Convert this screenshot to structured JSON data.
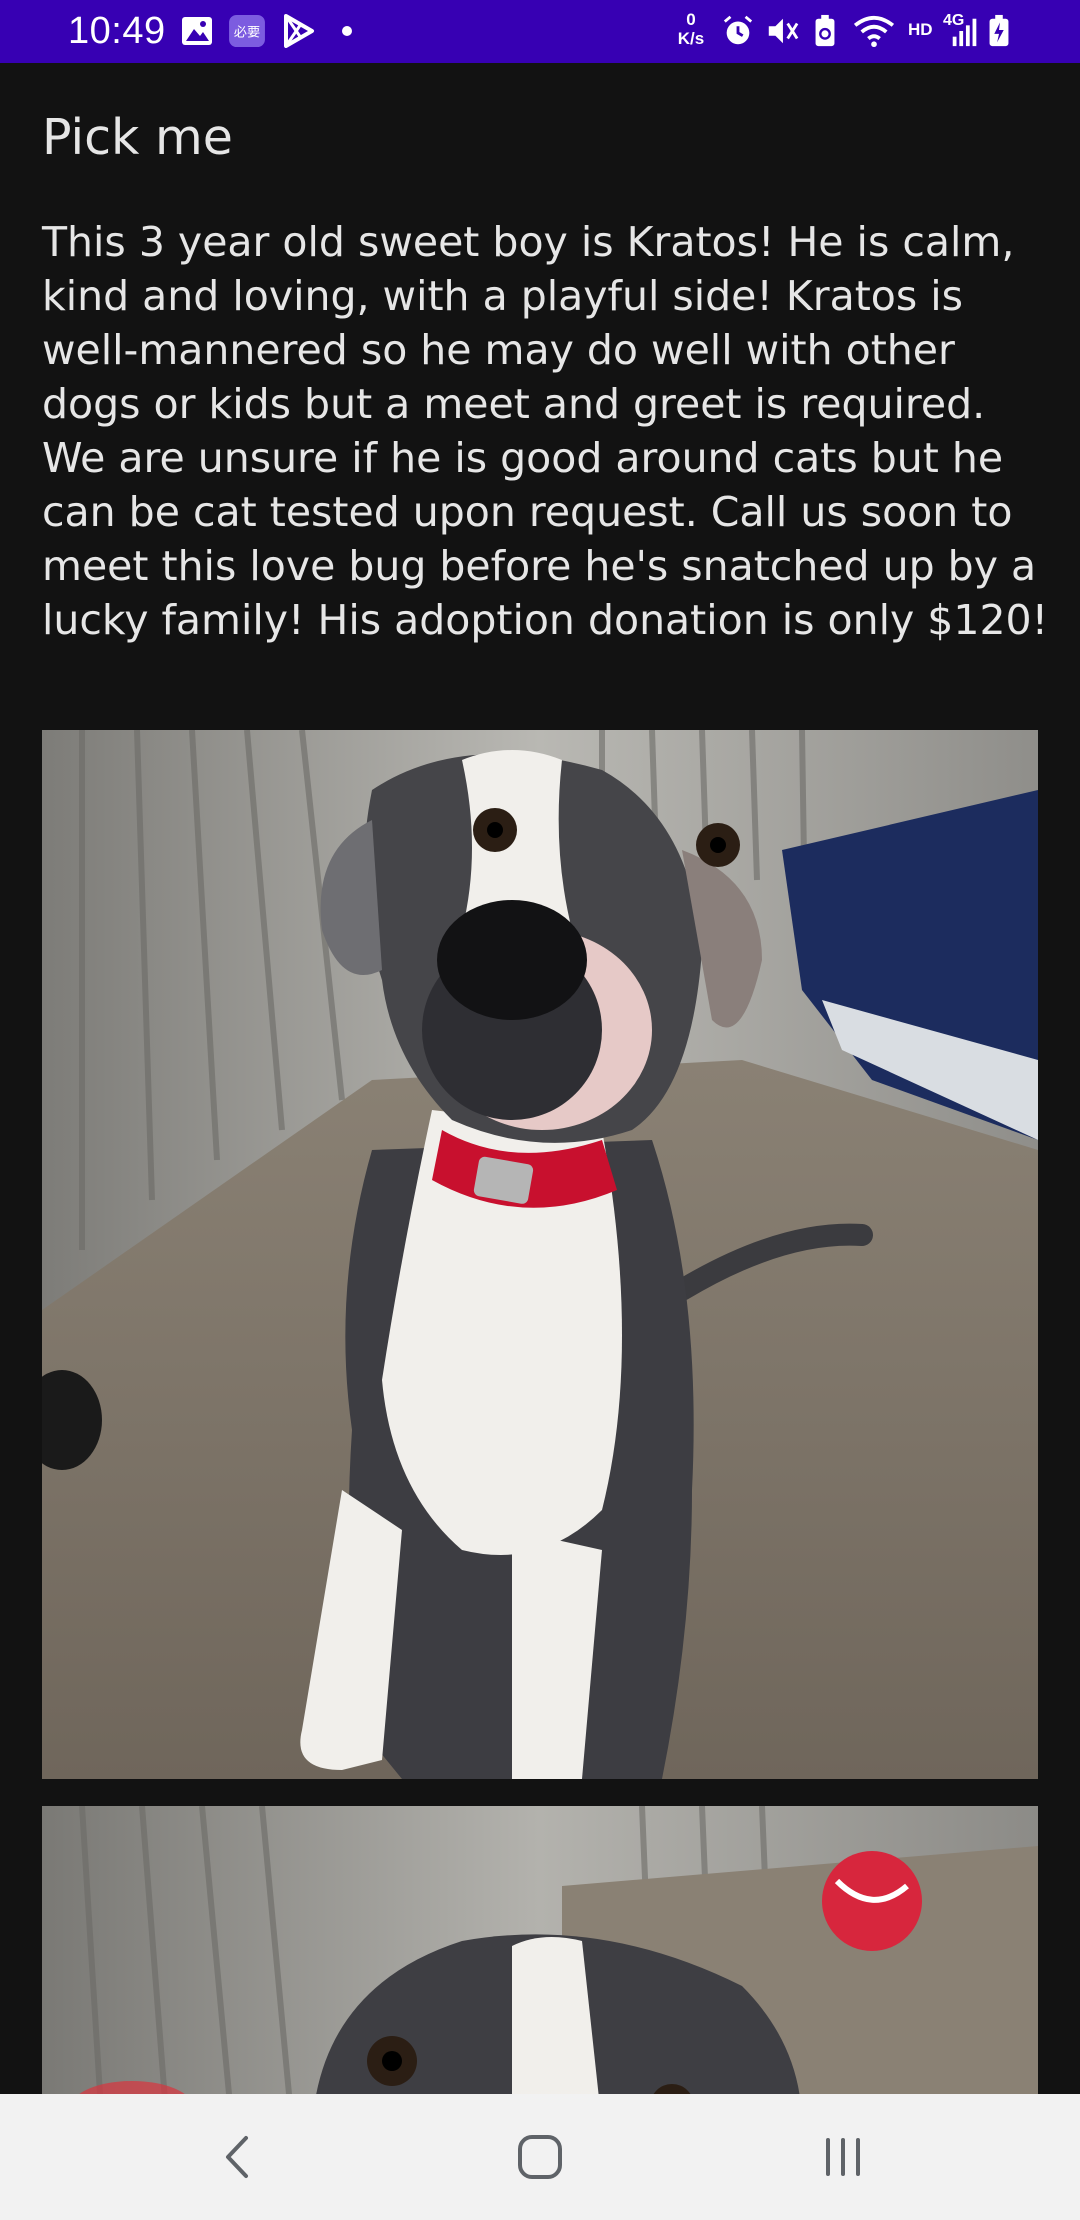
{
  "status_bar": {
    "time": "10:49",
    "net_speed_value": "0",
    "net_speed_unit": "K/s",
    "hd_label": "HD",
    "network_label": "4G",
    "icons": [
      "image-icon",
      "app-badge-icon",
      "play-store-icon",
      "dot-icon",
      "alarm-icon",
      "mute-icon",
      "battery-saver-icon",
      "wifi-icon",
      "signal-icon",
      "battery-charging-icon"
    ],
    "app_badge_text": "必要"
  },
  "page": {
    "title": "Pick me",
    "description": "This 3 year old sweet boy is Kratos! He is calm, kind and loving, with a playful side! Kratos is well-mannered so he may do well with other dogs or kids but a meet and greet is required. We are unsure if he is good around cats but he can be cat tested upon request. Call us soon to meet this love bug before he's snatched up by a lucky family!  His adoption donation is only $120!"
  },
  "photos": [
    "dog-photo-sitting",
    "dog-photo-closeup"
  ],
  "colors": {
    "status_bar": "#3700b3",
    "background": "#121212",
    "text": "#e6e6e6",
    "nav_bar": "#f2f2f2",
    "collar": "#c8102e"
  },
  "nav_bar": {
    "icons": [
      "back-icon",
      "home-icon",
      "recents-icon"
    ]
  }
}
